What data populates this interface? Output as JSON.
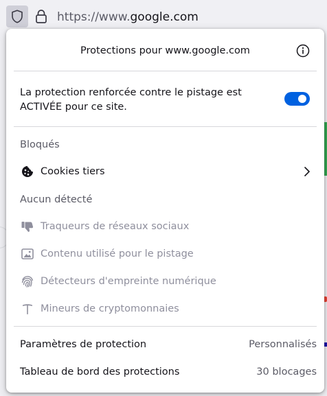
{
  "urlbar": {
    "url_prefix": "https://www.",
    "url_host": "google.com"
  },
  "panel": {
    "title": "Protections pour www.google.com",
    "etp_status_text": "La protection renforcée contre le pistage est ACTIVÉE pour ce site.",
    "etp_enabled": true,
    "blocked_heading": "Bloqués",
    "blocked_items": [
      {
        "label": "Cookies tiers",
        "icon": "cookie-icon"
      }
    ],
    "none_detected_heading": "Aucun détecté",
    "none_detected_items": [
      {
        "label": "Traqueurs de réseaux sociaux",
        "icon": "thumbs-down-icon"
      },
      {
        "label": "Contenu utilisé pour le pistage",
        "icon": "image-icon"
      },
      {
        "label": "Détecteurs d'empreinte numérique",
        "icon": "fingerprint-icon"
      },
      {
        "label": "Mineurs de cryptomonnaies",
        "icon": "pickaxe-icon"
      }
    ],
    "settings": {
      "label": "Paramètres de protection",
      "value": "Personnalisés"
    },
    "dashboard": {
      "label": "Tableau de bord des protections",
      "value": "30 blocages"
    }
  },
  "colors": {
    "accent": "#0061e0",
    "text_primary": "#15141a",
    "text_secondary": "#5b5b66",
    "text_muted": "#8f8f9d"
  }
}
